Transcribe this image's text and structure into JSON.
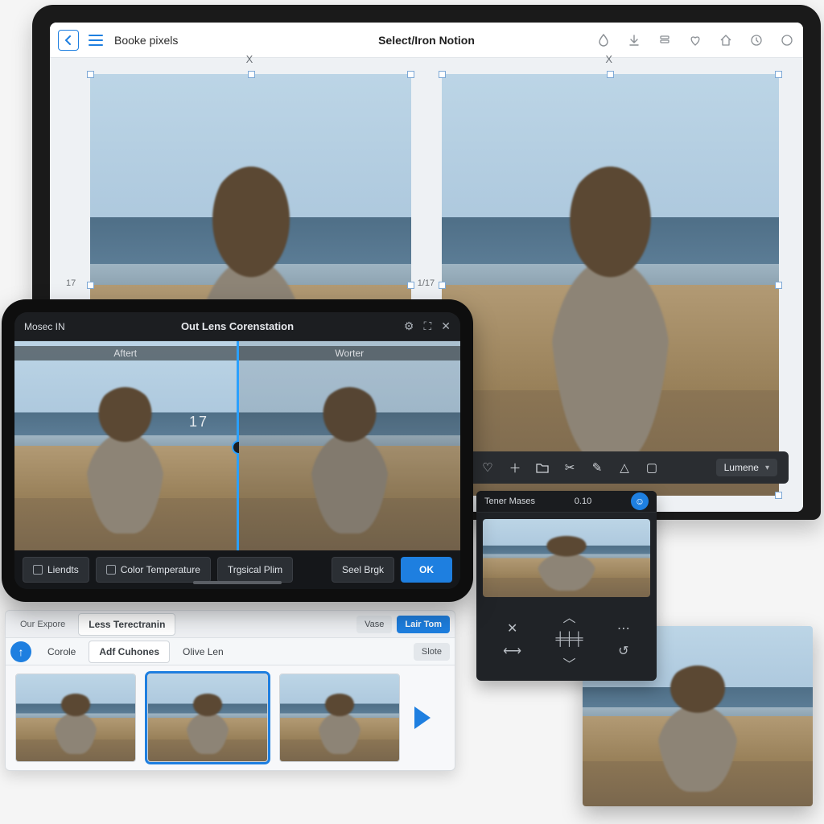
{
  "laptop": {
    "back_icon": "back",
    "menu_icon": "menu",
    "breadcrumb": "Booke pixels",
    "center_title": "Select/Iron Notion",
    "tools": [
      "drop",
      "download",
      "stack",
      "heart",
      "home",
      "clock",
      "circle"
    ],
    "left_ruler": "17",
    "right_ruler": "1/17",
    "close_label": "X",
    "dark_bar": {
      "tools": [
        "heart",
        "plus",
        "folder",
        "scissors",
        "pen",
        "triangle",
        "square"
      ],
      "dropdown_label": "Lumene",
      "dropdown_chev": "▾"
    }
  },
  "tablet": {
    "top_left_label": "Mosec IN",
    "center_title": "Out Lens Corenstation",
    "right_tools": [
      "gear",
      "expand",
      "close"
    ],
    "half_left_label": "Aftert",
    "half_right_label": "Worter",
    "overlay_number": "17",
    "buttons": {
      "liendts": "Liendts",
      "color_temp": "Color Temperature",
      "tropical": "Trgsical Plim",
      "seel": "Seel Brgk",
      "ok": "OK"
    }
  },
  "strip": {
    "left_small": "Our Expore",
    "tabs": [
      "Less Terectranin"
    ],
    "right_small_a": "Vase",
    "right_btn": "Lair Tom",
    "second_row": {
      "up_icon": "up",
      "items": [
        "Corole",
        "Adf Cuhones",
        "Olive Len"
      ],
      "right_btn": "Slote"
    }
  },
  "timer": {
    "title": "Tener Mases",
    "value": "0.10",
    "bubble_icon": "user",
    "ctrl_icons": [
      "close",
      "slider",
      "chev-up",
      "chev-down",
      "dots"
    ]
  }
}
